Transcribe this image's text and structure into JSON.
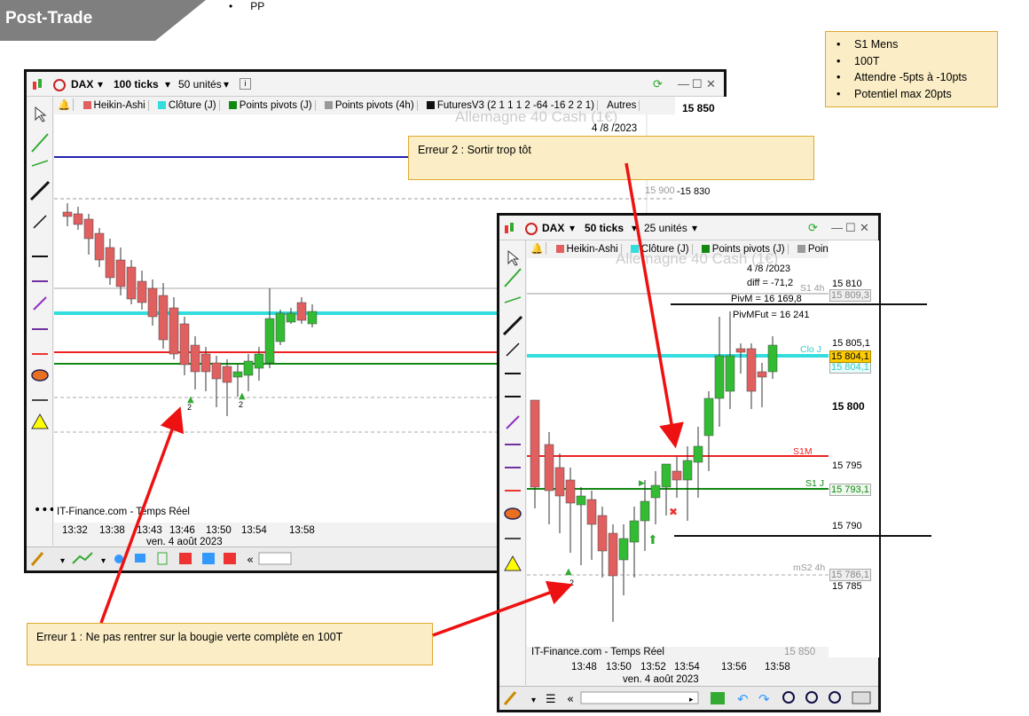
{
  "page": {
    "title": "Post-Trade",
    "bullet_pp": "PP",
    "strategy_notes": [
      "S1 Mens",
      "100T",
      "Attendre -5pts à -10pts",
      "Potentiel max 20pts"
    ],
    "error2": "Erreur 2 : Sortir trop tôt",
    "error1": "Erreur 1 : Ne pas rentrer sur la bougie verte complète en 100T"
  },
  "colors": {
    "banner": "#7f7f7f",
    "note_bg": "#fbeec6",
    "note_border": "#e0a830",
    "bull": "#33bb33",
    "bear": "#e06060",
    "cyan": "#33dddd",
    "red_line": "#ee2222",
    "green_line": "#118811",
    "blue_line": "#2222aa",
    "arrow": "#ee1111"
  },
  "window1": {
    "instrument": "DAX",
    "ticks": "100 ticks",
    "units": "50 unités",
    "indicators": [
      "Heikin-Ashi",
      "Clôture (J)",
      "Points pivots (J)",
      "Points pivots (4h)",
      "FuturesV3 (2 1 1 1 2 -64 -16 2 2 1)",
      "Autres"
    ],
    "indicator_colors": [
      "#e06060",
      "#33dddd",
      "#118811",
      "#999999",
      "#111111",
      ""
    ],
    "watermark": "Allemagne 40 Cash (1€)",
    "date_header": "4 /8 /2023",
    "price_labels": [
      "15 850",
      "15 830"
    ],
    "grid_label": "15 900",
    "source": "IT-Finance.com - Temps Réel",
    "times": [
      "13:32",
      "13:38",
      "13:43",
      "13:46",
      "13:50",
      "13:54",
      "13:58"
    ],
    "date_footer": "ven. 4 août 2023",
    "signal_counts": [
      "2",
      "2"
    ]
  },
  "window2": {
    "instrument": "DAX",
    "ticks": "50 ticks",
    "units": "25 unités",
    "indicators": [
      "Heikin-Ashi",
      "Clôture (J)",
      "Points pivots (J)",
      "Points pivo"
    ],
    "indicator_colors": [
      "#e06060",
      "#33dddd",
      "#118811",
      "#999999"
    ],
    "watermark": "Allemagne 40 Cash (1€)",
    "info_lines": [
      "4 /8 /2023",
      "diff = -71,2",
      "PivM = 16 169,8",
      "PivMFut = 16 241"
    ],
    "line_labels": {
      "s1_4h": "S1 4h",
      "clo_j": "Clo J",
      "s1m": "S1M",
      "s1j": "S1 J",
      "ms2_4h": "mS2 4h"
    },
    "price_axis": [
      "15 810",
      "15 805,1",
      "15 800",
      "15 795",
      "15 790",
      "15 785"
    ],
    "level_tags": {
      "s1_4h": "15 809,3",
      "close": "15 804,1",
      "close_under": "15 804,1",
      "s1j": "15 793,1",
      "ms2": "15 786,1"
    },
    "source": "IT-Finance.com - Temps Réel",
    "source_price": "15 850",
    "times": [
      "13:48",
      "13:50",
      "13:52",
      "13:54",
      "13:56",
      "13:58"
    ],
    "date_footer": "ven. 4 août 2023",
    "signal_count": "2"
  }
}
